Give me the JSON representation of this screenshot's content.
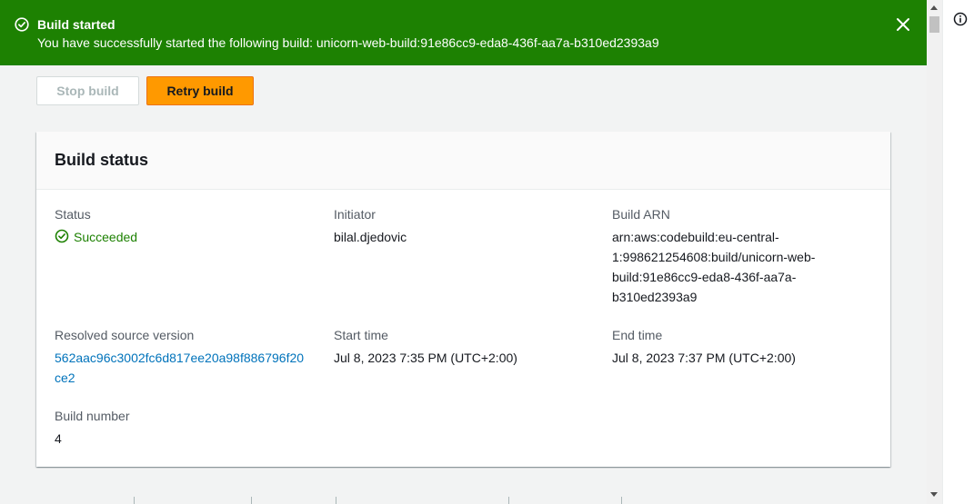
{
  "flash": {
    "title": "Build started",
    "message": "You have successfully started the following build: unicorn-web-build:91e86cc9-eda8-436f-aa7a-b310ed2393a9",
    "color": "#1d8102"
  },
  "actions": {
    "stop_label": "Stop build",
    "retry_label": "Retry build"
  },
  "build_status": {
    "title": "Build status",
    "status_label": "Status",
    "status_value": "Succeeded",
    "initiator_label": "Initiator",
    "initiator_value": "bilal.djedovic",
    "arn_label": "Build ARN",
    "arn_line1": "arn:aws:codebuild:eu-central-",
    "arn_line2": "1:998621254608:build/unicorn-web-",
    "arn_line3": "build:91e86cc9-eda8-436f-aa7a-",
    "arn_line4": "b310ed2393a9",
    "source_label": "Resolved source version",
    "source_line1": "562aac96c3002fc6d817ee20a98f886796f20",
    "source_line2": "ce2",
    "start_label": "Start time",
    "start_value": "Jul 8, 2023 7:35 PM (UTC+2:00)",
    "end_label": "End time",
    "end_value": "Jul 8, 2023 7:37 PM (UTC+2:00)",
    "build_number_label": "Build number",
    "build_number_value": "4"
  },
  "icons": {
    "flash_status": "check-circle-icon",
    "close": "close-icon",
    "info": "info-icon",
    "status": "check-circle-icon"
  }
}
